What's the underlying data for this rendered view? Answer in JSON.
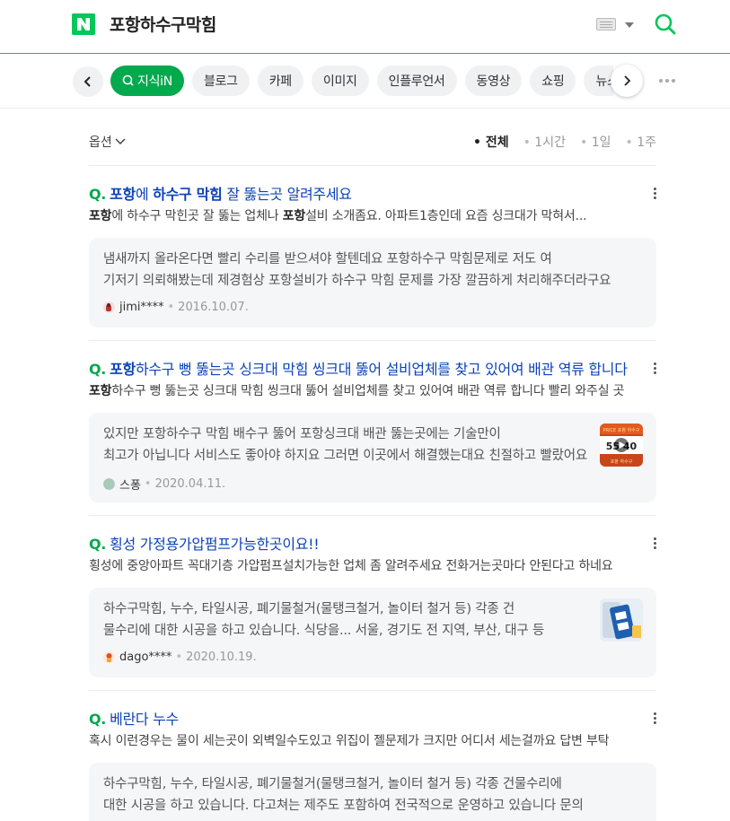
{
  "header": {
    "query": "포항하수구막힘",
    "brand_color": "#03c75a"
  },
  "tabs": [
    {
      "label": "지식iN",
      "active": true
    },
    {
      "label": "블로그"
    },
    {
      "label": "카페"
    },
    {
      "label": "이미지"
    },
    {
      "label": "인플루언서"
    },
    {
      "label": "동영상"
    },
    {
      "label": "쇼핑"
    },
    {
      "label": "뉴스"
    }
  ],
  "filters": {
    "options_label": "옵션",
    "periods": [
      "전체",
      "1시간",
      "1일",
      "1주"
    ]
  },
  "results": [
    {
      "q": "Q.",
      "title_hl": "포항",
      "title_mid": "에 ",
      "title_hl2": "하수구 막힘",
      "title_rest": " 잘 뚫는곳 알려주세요",
      "desc_hl": "포항",
      "desc_mid": "에 하수구 막힌곳 잘 뚫는 업체나 ",
      "desc_hl2": "포항",
      "desc_rest": "설비 소개좀요. 아파트1층인데 요즘 싱크대가 막혀서...",
      "answer_line1": "냄새까지 올라온다면 빨리 수리를 받으셔야 할텐데요 포항하수구 막힘문제로 저도 여",
      "answer_line2": "기저기 의뢰해봤는데 제경험상 포항설비가 하수구 막힘 문제를 가장 깔끔하게 처리해주더라구요",
      "user": "jimi****",
      "date": "2016.10.07."
    },
    {
      "q": "Q.",
      "title_hl": "포항",
      "title_mid": "하수구 뻥 뚫는곳 싱크대 막힘 씽크대 뚫어 설비업체를 찾고 있어여 배관 역류 합니다",
      "title_hl2": "",
      "title_rest": "",
      "desc_hl": "포항",
      "desc_mid": "하수구 뻥 뚫는곳 싱크대 막힘 씽크대 뚫어 설비업체를 찾고 있어여 배관 역류 합니다 빨리 와주실 곳",
      "desc_hl2": "",
      "desc_rest": "",
      "answer_line1": "있지만 포항하수구 막힘 배수구 뚫어 포항싱크대 배관 뚫는곳에는 기술만이",
      "answer_line2": "최고가 아닙니다 서비스도 좋아야 하지요 그러면 이곳에서 해결했는대요 친절하고 빨랐어요",
      "user": "스퐁",
      "date": "2020.04.11."
    },
    {
      "q": "Q.",
      "title_hl": "",
      "title_mid": "횡성 가정용가압펌프가능한곳이요!!",
      "title_hl2": "",
      "title_rest": "",
      "desc_hl": "",
      "desc_mid": "횡성에 중앙아파트 꼭대기층 가압펌프설치가능한 업체 좀 알려주세요 전화거는곳마다 안된다고 하네요",
      "desc_hl2": "",
      "desc_rest": "",
      "answer_line1": "하수구막힘, 누수, 타일시공, 폐기물철거(물탱크철거, 놀이터 철거 등) 각종 건",
      "answer_line2": "물수리에 대한 시공을 하고 있습니다. 식당을... 서울, 경기도 전 지역, 부산, 대구 등",
      "user": "dago****",
      "date": "2020.10.19."
    },
    {
      "q": "Q.",
      "title_hl": "",
      "title_mid": "베란다 누수",
      "title_hl2": "",
      "title_rest": "",
      "desc_hl": "",
      "desc_mid": "혹시 이런경우는 물이 세는곳이 외벽일수도있고 위집이 젤문제가 크지만 어디서 세는걸까요 답변 부탁",
      "desc_hl2": "",
      "desc_rest": "",
      "answer_line1": "하수구막힘, 누수, 타일시공, 폐기물철거(물탱크철거, 놀이터 철거 등) 각종 건물수리에",
      "answer_line2": "대한 시공을 하고 있습니다. 다고쳐는 제주도 포함하여 전국적으로 운영하고 있습니다 문의",
      "user": "",
      "date": ""
    }
  ],
  "thumb2": {
    "top": "PRICE 포항 하수구",
    "num": "55 40",
    "bottom": "포항 하수구"
  }
}
